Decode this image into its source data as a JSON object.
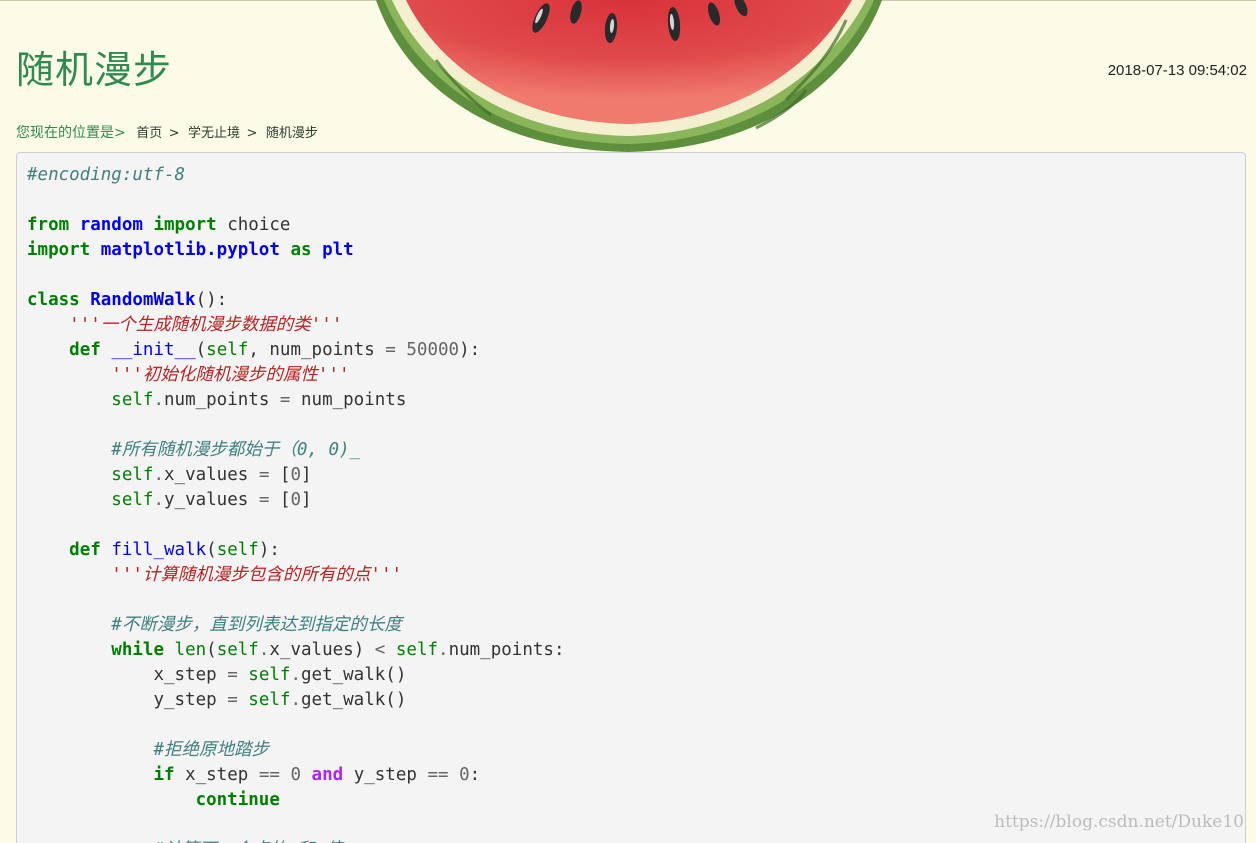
{
  "post": {
    "title": "随机漫步",
    "date": "2018-07-13 09:54:02"
  },
  "breadcrumb": {
    "prefix": "您现在的位置是>",
    "items": [
      {
        "label": "首页",
        "sep": ">"
      },
      {
        "label": "学无止境",
        "sep": ">"
      },
      {
        "label": "随机漫步",
        "sep": ""
      }
    ]
  },
  "code": {
    "language": "python",
    "lines": [
      [
        {
          "t": "c",
          "v": "#encoding:utf-8"
        }
      ],
      [],
      [
        {
          "t": "k",
          "v": "from"
        },
        {
          "t": "",
          "v": " "
        },
        {
          "t": "nn",
          "v": "random"
        },
        {
          "t": "",
          "v": " "
        },
        {
          "t": "k",
          "v": "import"
        },
        {
          "t": "",
          "v": " "
        },
        {
          "t": "n",
          "v": "choice"
        }
      ],
      [
        {
          "t": "k",
          "v": "import"
        },
        {
          "t": "",
          "v": " "
        },
        {
          "t": "nn",
          "v": "matplotlib.pyplot"
        },
        {
          "t": "",
          "v": " "
        },
        {
          "t": "k",
          "v": "as"
        },
        {
          "t": "",
          "v": " "
        },
        {
          "t": "nn",
          "v": "plt"
        }
      ],
      [],
      [
        {
          "t": "k",
          "v": "class"
        },
        {
          "t": "",
          "v": " "
        },
        {
          "t": "nc",
          "v": "RandomWalk"
        },
        {
          "t": "p",
          "v": "():"
        }
      ],
      [
        {
          "t": "",
          "v": "    "
        },
        {
          "t": "s",
          "v": "'''一个生成随机漫步数据的类'''"
        }
      ],
      [
        {
          "t": "",
          "v": "    "
        },
        {
          "t": "k",
          "v": "def"
        },
        {
          "t": "",
          "v": " "
        },
        {
          "t": "nf",
          "v": "__init__"
        },
        {
          "t": "p",
          "v": "("
        },
        {
          "t": "bp",
          "v": "self"
        },
        {
          "t": "p",
          "v": ", "
        },
        {
          "t": "n",
          "v": "num_points"
        },
        {
          "t": "",
          "v": " "
        },
        {
          "t": "o",
          "v": "="
        },
        {
          "t": "",
          "v": " "
        },
        {
          "t": "m",
          "v": "50000"
        },
        {
          "t": "p",
          "v": "):"
        }
      ],
      [
        {
          "t": "",
          "v": "        "
        },
        {
          "t": "s",
          "v": "'''初始化随机漫步的属性'''"
        }
      ],
      [
        {
          "t": "",
          "v": "        "
        },
        {
          "t": "bp",
          "v": "self"
        },
        {
          "t": "o",
          "v": "."
        },
        {
          "t": "n",
          "v": "num_points"
        },
        {
          "t": "",
          "v": " "
        },
        {
          "t": "o",
          "v": "="
        },
        {
          "t": "",
          "v": " "
        },
        {
          "t": "n",
          "v": "num_points"
        }
      ],
      [],
      [
        {
          "t": "",
          "v": "        "
        },
        {
          "t": "c",
          "v": "#所有随机漫步都始于（0, 0)_"
        }
      ],
      [
        {
          "t": "",
          "v": "        "
        },
        {
          "t": "bp",
          "v": "self"
        },
        {
          "t": "o",
          "v": "."
        },
        {
          "t": "n",
          "v": "x_values"
        },
        {
          "t": "",
          "v": " "
        },
        {
          "t": "o",
          "v": "="
        },
        {
          "t": "",
          "v": " "
        },
        {
          "t": "p",
          "v": "["
        },
        {
          "t": "m",
          "v": "0"
        },
        {
          "t": "p",
          "v": "]"
        }
      ],
      [
        {
          "t": "",
          "v": "        "
        },
        {
          "t": "bp",
          "v": "self"
        },
        {
          "t": "o",
          "v": "."
        },
        {
          "t": "n",
          "v": "y_values"
        },
        {
          "t": "",
          "v": " "
        },
        {
          "t": "o",
          "v": "="
        },
        {
          "t": "",
          "v": " "
        },
        {
          "t": "p",
          "v": "["
        },
        {
          "t": "m",
          "v": "0"
        },
        {
          "t": "p",
          "v": "]"
        }
      ],
      [],
      [
        {
          "t": "",
          "v": "    "
        },
        {
          "t": "k",
          "v": "def"
        },
        {
          "t": "",
          "v": " "
        },
        {
          "t": "nf",
          "v": "fill_walk"
        },
        {
          "t": "p",
          "v": "("
        },
        {
          "t": "bp",
          "v": "self"
        },
        {
          "t": "p",
          "v": "):"
        }
      ],
      [
        {
          "t": "",
          "v": "        "
        },
        {
          "t": "s",
          "v": "'''计算随机漫步包含的所有的点'''"
        }
      ],
      [],
      [
        {
          "t": "",
          "v": "        "
        },
        {
          "t": "c",
          "v": "#不断漫步，直到列表达到指定的长度"
        }
      ],
      [
        {
          "t": "",
          "v": "        "
        },
        {
          "t": "k",
          "v": "while"
        },
        {
          "t": "",
          "v": " "
        },
        {
          "t": "bp",
          "v": "len"
        },
        {
          "t": "p",
          "v": "("
        },
        {
          "t": "bp",
          "v": "self"
        },
        {
          "t": "o",
          "v": "."
        },
        {
          "t": "n",
          "v": "x_values"
        },
        {
          "t": "p",
          "v": ")"
        },
        {
          "t": "",
          "v": " "
        },
        {
          "t": "o",
          "v": "<"
        },
        {
          "t": "",
          "v": " "
        },
        {
          "t": "bp",
          "v": "self"
        },
        {
          "t": "o",
          "v": "."
        },
        {
          "t": "n",
          "v": "num_points"
        },
        {
          "t": "p",
          "v": ":"
        }
      ],
      [
        {
          "t": "",
          "v": "            "
        },
        {
          "t": "n",
          "v": "x_step"
        },
        {
          "t": "",
          "v": " "
        },
        {
          "t": "o",
          "v": "="
        },
        {
          "t": "",
          "v": " "
        },
        {
          "t": "bp",
          "v": "self"
        },
        {
          "t": "o",
          "v": "."
        },
        {
          "t": "n",
          "v": "get_walk"
        },
        {
          "t": "p",
          "v": "()"
        }
      ],
      [
        {
          "t": "",
          "v": "            "
        },
        {
          "t": "n",
          "v": "y_step"
        },
        {
          "t": "",
          "v": " "
        },
        {
          "t": "o",
          "v": "="
        },
        {
          "t": "",
          "v": " "
        },
        {
          "t": "bp",
          "v": "self"
        },
        {
          "t": "o",
          "v": "."
        },
        {
          "t": "n",
          "v": "get_walk"
        },
        {
          "t": "p",
          "v": "()"
        }
      ],
      [],
      [
        {
          "t": "",
          "v": "            "
        },
        {
          "t": "c",
          "v": "#拒绝原地踏步"
        }
      ],
      [
        {
          "t": "",
          "v": "            "
        },
        {
          "t": "k",
          "v": "if"
        },
        {
          "t": "",
          "v": " "
        },
        {
          "t": "n",
          "v": "x_step"
        },
        {
          "t": "",
          "v": " "
        },
        {
          "t": "o",
          "v": "=="
        },
        {
          "t": "",
          "v": " "
        },
        {
          "t": "m",
          "v": "0"
        },
        {
          "t": "",
          "v": " "
        },
        {
          "t": "ow",
          "v": "and"
        },
        {
          "t": "",
          "v": " "
        },
        {
          "t": "n",
          "v": "y_step"
        },
        {
          "t": "",
          "v": " "
        },
        {
          "t": "o",
          "v": "=="
        },
        {
          "t": "",
          "v": " "
        },
        {
          "t": "m",
          "v": "0"
        },
        {
          "t": "p",
          "v": ":"
        }
      ],
      [
        {
          "t": "",
          "v": "                "
        },
        {
          "t": "k",
          "v": "continue"
        }
      ],
      [],
      [
        {
          "t": "",
          "v": "            "
        },
        {
          "t": "c",
          "v": "#计算下一个点的x和y值"
        }
      ]
    ]
  },
  "watermark": "https://blog.csdn.net/Duke10",
  "colors": {
    "page_background": "#fbfbe8",
    "title_green": "#2f8a4e",
    "code_background": "#f4f4f4",
    "keyword": "#008000",
    "name_blue": "#0000ff",
    "string_red": "#ba2121",
    "comment_teal": "#408080",
    "operator_word_purple": "#aa22ff"
  }
}
